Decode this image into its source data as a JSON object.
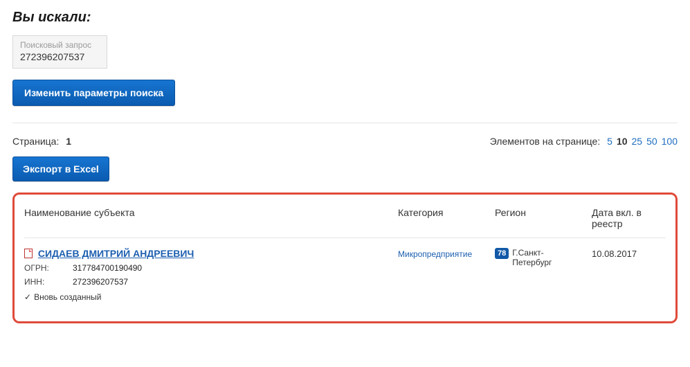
{
  "heading": "Вы искали:",
  "query": {
    "label": "Поисковый запрос",
    "value": "272396207537"
  },
  "buttons": {
    "change_params": "Изменить параметры поиска",
    "export": "Экспорт в Excel"
  },
  "pager": {
    "page_label": "Страница:",
    "page_current": "1",
    "per_page_label": "Элементов на странице:",
    "per_page_options": [
      "5",
      "10",
      "25",
      "50",
      "100"
    ],
    "per_page_active": "10"
  },
  "headers": {
    "name": "Наименование субъекта",
    "category": "Категория",
    "region": "Регион",
    "date": "Дата вкл. в реестр"
  },
  "row": {
    "subject_name": "СИДАЕВ ДМИТРИЙ АНДРЕЕВИЧ",
    "ogrn_label": "ОГРН:",
    "ogrn_value": "317784700190490",
    "inn_label": "ИНН:",
    "inn_value": "272396207537",
    "status": "Вновь созданный",
    "category": "Микропредприятие",
    "region_code": "78",
    "region_name": "Г.Санкт-Петербург",
    "date": "10.08.2017"
  }
}
